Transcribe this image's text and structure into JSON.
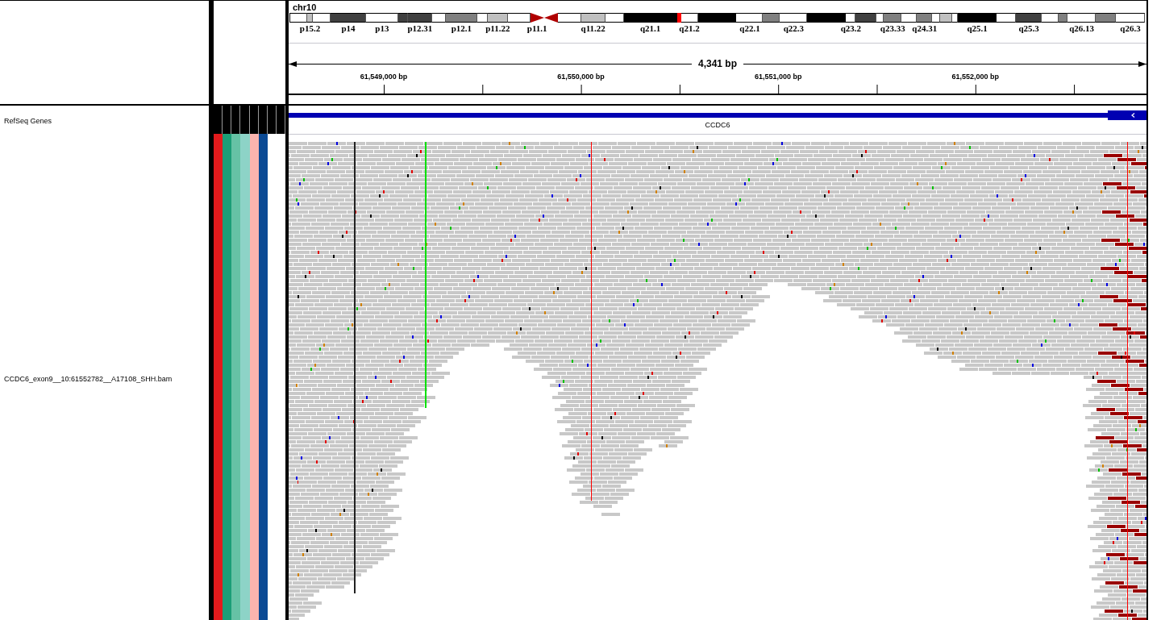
{
  "header": {
    "chromosome": "chr10",
    "ideogram": [
      {
        "kind": "gneg"
      },
      {
        "kind": "gpos25",
        "label": "p15.2"
      },
      {
        "kind": "gneg"
      },
      {
        "kind": "gpos75",
        "label": "p14"
      },
      {
        "kind": "gneg",
        "label": "p13"
      },
      {
        "kind": "gpos75"
      },
      {
        "kind": "gpos75",
        "label": "p12.31"
      },
      {
        "kind": "gneg"
      },
      {
        "kind": "gpos50",
        "label": "p12.1"
      },
      {
        "kind": "gneg"
      },
      {
        "kind": "gpos25",
        "label": "p11.22"
      },
      {
        "kind": "gneg"
      },
      {
        "kind": "acen_p",
        "label": "p11.1"
      },
      {
        "kind": "acen_q"
      },
      {
        "kind": "gneg"
      },
      {
        "kind": "gpos25",
        "label": "q11.22"
      },
      {
        "kind": "gneg"
      },
      {
        "kind": "gpos100",
        "label": "q21.1"
      },
      {
        "kind": "view"
      },
      {
        "kind": "gneg",
        "label": "q21.2"
      },
      {
        "kind": "gpos100"
      },
      {
        "kind": "gneg",
        "label": "q22.1"
      },
      {
        "kind": "gpos50"
      },
      {
        "kind": "gneg",
        "label": "q22.3"
      },
      {
        "kind": "gpos100"
      },
      {
        "kind": "gneg",
        "label": "q23.2"
      },
      {
        "kind": "gpos75"
      },
      {
        "kind": "gneg"
      },
      {
        "kind": "gpos50",
        "label": "q23.33"
      },
      {
        "kind": "gneg"
      },
      {
        "kind": "gpos50",
        "label": "q24.31"
      },
      {
        "kind": "gneg"
      },
      {
        "kind": "gpos25"
      },
      {
        "kind": "gneg"
      },
      {
        "kind": "gpos100",
        "label": "q25.1"
      },
      {
        "kind": "gneg"
      },
      {
        "kind": "gpos75",
        "label": "q25.3"
      },
      {
        "kind": "gneg"
      },
      {
        "kind": "gpos50"
      },
      {
        "kind": "gneg",
        "label": "q26.13"
      },
      {
        "kind": "gpos50"
      },
      {
        "kind": "gneg",
        "label": "q26.3"
      }
    ],
    "span": "4,341 bp",
    "ticks": [
      "61,549,000 bp",
      "61,550,000 bp",
      "61,551,000 bp",
      "61,552,000 bp"
    ]
  },
  "attributes": [
    {
      "color": "#e31a1c"
    },
    {
      "color": "#1b9e77"
    },
    {
      "color": "#66c2a5"
    },
    {
      "color": "#8dd3c7"
    },
    {
      "color": "#fbb4ae"
    },
    {
      "color": "#0b4a94"
    },
    {
      "color": "#ffffff"
    },
    {
      "color": "#ffffff"
    }
  ],
  "tracks": [
    {
      "kind": "gene",
      "name": "RefSeq Genes",
      "gene": "CCDC6",
      "reverse_strand": true
    },
    {
      "kind": "alignment",
      "name": "CCDC6_exon9__10:61552782__A17108_SHH.bam"
    }
  ]
}
